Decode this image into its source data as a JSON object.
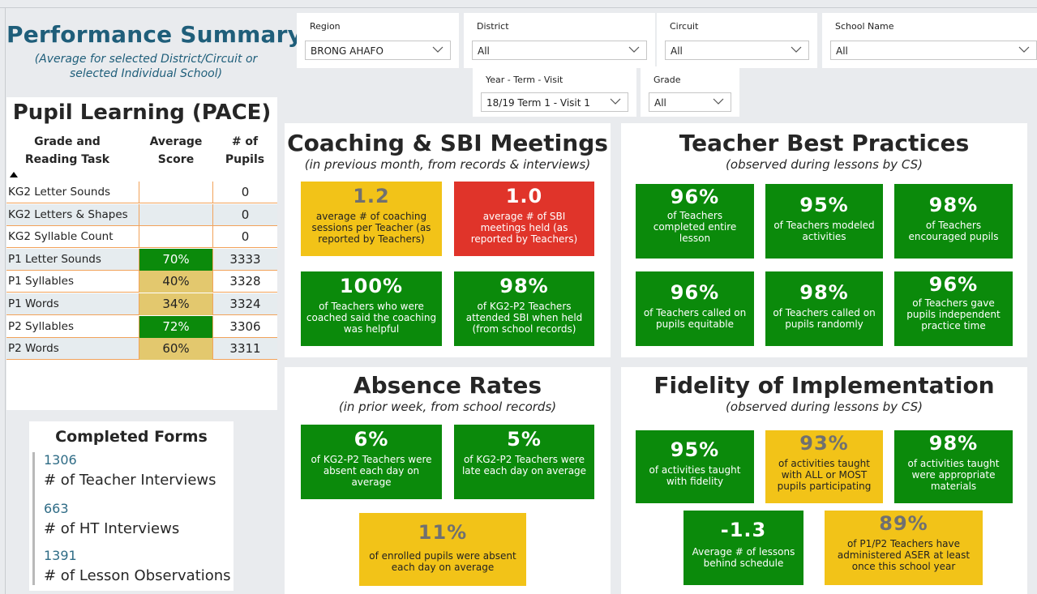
{
  "header": {
    "title": "Performance Summary",
    "subtitle": "(Average for selected District/Circuit or selected Individual School)"
  },
  "slicers": {
    "region": {
      "label": "Region",
      "value": "BRONG AHAFO"
    },
    "district": {
      "label": "District",
      "value": "All"
    },
    "circuit": {
      "label": "Circuit",
      "value": "All"
    },
    "school": {
      "label": "School Name",
      "value": "All"
    },
    "year_term": {
      "label": "Year - Term - Visit",
      "value": "18/19 Term 1 - Visit 1"
    },
    "grade": {
      "label": "Grade",
      "value": "All"
    }
  },
  "pupil_learning": {
    "title": "Pupil Learning (PACE)",
    "columns": [
      "Grade and Reading Task",
      "Average Score",
      "# of Pupils"
    ],
    "rows": [
      {
        "task": "KG2 Letter Sounds",
        "score": "",
        "pupils": "0",
        "score_color": ""
      },
      {
        "task": "KG2 Letters & Shapes",
        "score": "",
        "pupils": "0",
        "score_color": ""
      },
      {
        "task": "KG2 Syllable Count",
        "score": "",
        "pupils": "0",
        "score_color": ""
      },
      {
        "task": "P1 Letter Sounds",
        "score": "70%",
        "pupils": "3333",
        "score_color": "#0b8a0b"
      },
      {
        "task": "P1 Syllables",
        "score": "40%",
        "pupils": "3328",
        "score_color": "#e3c86e"
      },
      {
        "task": "P1 Words",
        "score": "34%",
        "pupils": "3324",
        "score_color": "#e3c86e"
      },
      {
        "task": "P2 Syllables",
        "score": "72%",
        "pupils": "3306",
        "score_color": "#0b8a0b"
      },
      {
        "task": "P2 Words",
        "score": "60%",
        "pupils": "3311",
        "score_color": "#e3c86e"
      }
    ]
  },
  "completed_forms": {
    "title": "Completed Forms",
    "items": [
      {
        "count": "1306",
        "label": "# of Teacher Interviews"
      },
      {
        "count": "663",
        "label": "# of HT Interviews"
      },
      {
        "count": "1391",
        "label": "# of Lesson Observations"
      }
    ]
  },
  "coaching": {
    "title": "Coaching & SBI Meetings",
    "subtitle": "(in previous month, from records & interviews)",
    "tiles": [
      {
        "value": "1.2",
        "text": "average # of coaching sessions per Teacher (as reported by Teachers)",
        "color": "yellow"
      },
      {
        "value": "1.0",
        "text": "average # of SBI meetings held (as reported by Teachers)",
        "color": "red"
      },
      {
        "value": "100%",
        "text": "of Teachers who were coached said the coaching was helpful",
        "color": "green"
      },
      {
        "value": "98%",
        "text": "of KG2-P2 Teachers attended SBI when held (from school records)",
        "color": "green"
      }
    ]
  },
  "best_practices": {
    "title": "Teacher Best Practices",
    "subtitle": "(observed during lessons by CS)",
    "tiles": [
      {
        "value": "96%",
        "text": "of Teachers completed entire lesson",
        "color": "green"
      },
      {
        "value": "95%",
        "text": "of Teachers modeled activities",
        "color": "green"
      },
      {
        "value": "98%",
        "text": "of Teachers encouraged pupils",
        "color": "green"
      },
      {
        "value": "96%",
        "text": "of Teachers called on pupils equitable",
        "color": "green"
      },
      {
        "value": "98%",
        "text": "of Teachers called on pupils randomly",
        "color": "green"
      },
      {
        "value": "96%",
        "text": "of Teachers gave pupils independent practice time",
        "color": "green"
      }
    ]
  },
  "absence": {
    "title": "Absence Rates",
    "subtitle": "(in prior week, from school records)",
    "tiles": [
      {
        "value": "6%",
        "text": "of KG2-P2 Teachers were absent each day on average",
        "color": "green"
      },
      {
        "value": "5%",
        "text": "of KG2-P2 Teachers were late each day on average",
        "color": "green"
      },
      {
        "value": "11%",
        "text": "of enrolled pupils were absent each day on average",
        "color": "yellow"
      }
    ]
  },
  "fidelity": {
    "title": "Fidelity of Implementation",
    "subtitle": "(observed during lessons by CS)",
    "tiles": [
      {
        "value": "95%",
        "text": "of activities taught with fidelity",
        "color": "green"
      },
      {
        "value": "93%",
        "text": "of activities taught with ALL or MOST pupils participating",
        "color": "yellow"
      },
      {
        "value": "98%",
        "text": "of activities taught were appropriate materials",
        "color": "green"
      },
      {
        "value": "-1.3",
        "text": "Average # of lessons behind schedule",
        "color": "green"
      },
      {
        "value": "89%",
        "text": "of P1/P2 Teachers have administered ASER at least once this school year",
        "color": "yellow"
      }
    ]
  },
  "colors": {
    "title_blue": "#1f5e7a",
    "green": "#0b8a0b",
    "yellow": "#f2c318",
    "red": "#e0342a",
    "row_alt": "#e6ecef",
    "grid_orange": "#f2a25a"
  }
}
